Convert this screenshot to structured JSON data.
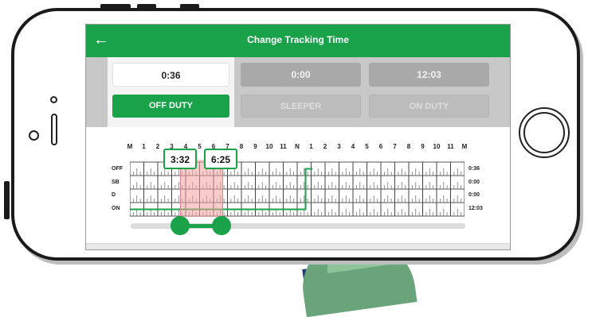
{
  "header": {
    "title": "Change Tracking Time",
    "back_icon": "back-arrow-icon"
  },
  "statuses": [
    {
      "time": "0:36",
      "label": "OFF DUTY",
      "active": true
    },
    {
      "time": "0:00",
      "label": "SLEEPER",
      "active": false
    },
    {
      "time": "12:03",
      "label": "ON DUTY",
      "active": false
    }
  ],
  "chart": {
    "hours": [
      "M",
      "1",
      "2",
      "3",
      "4",
      "5",
      "6",
      "7",
      "8",
      "9",
      "10",
      "11",
      "N",
      "1",
      "2",
      "3",
      "4",
      "5",
      "6",
      "7",
      "8",
      "9",
      "10",
      "11",
      "M"
    ],
    "rows": [
      {
        "label": "OFF",
        "total": "0:36"
      },
      {
        "label": "SB",
        "total": "0:00"
      },
      {
        "label": "D",
        "total": "0:00"
      },
      {
        "label": "ON",
        "total": "12:03"
      }
    ],
    "selection_start": "3:32",
    "selection_end": "6:25"
  },
  "colors": {
    "accent": "#1aa24a",
    "selection": "#f4a0a0",
    "inactive": "#a9a9a9"
  }
}
